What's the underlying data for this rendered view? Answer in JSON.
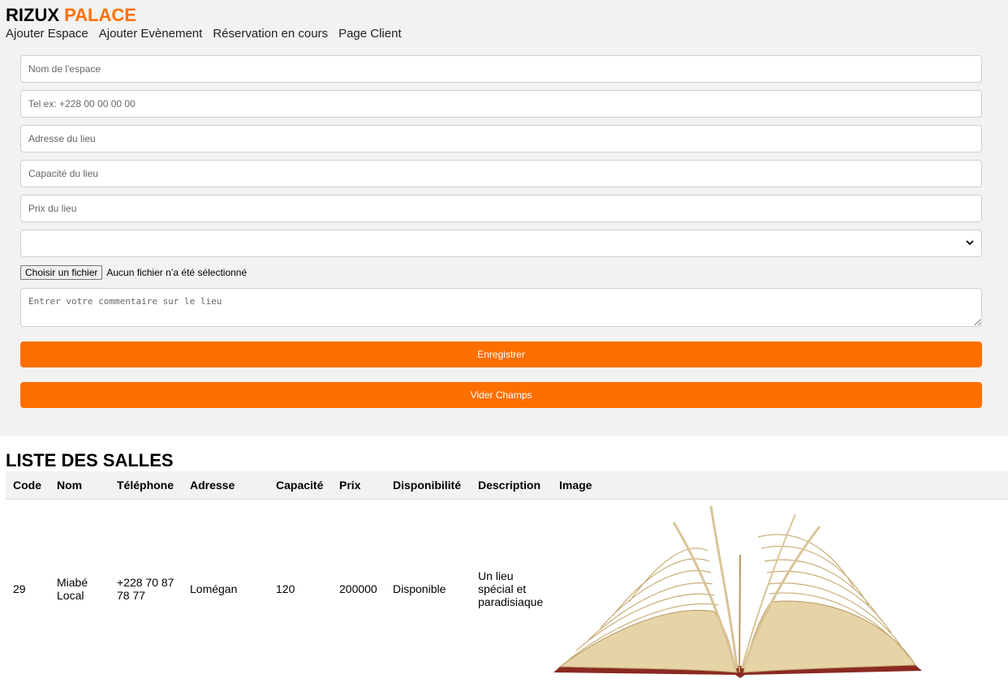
{
  "brand": {
    "name_part1": "RIZUX",
    "name_part2": "PALACE"
  },
  "nav": {
    "items": [
      "Ajouter Espace",
      "Ajouter Evènement",
      "Réservation en cours",
      "Page Client"
    ]
  },
  "form": {
    "nom_placeholder": "Nom de l'espace",
    "tel_placeholder": "Tel ex: +228 00 00 00 00",
    "adresse_placeholder": "Adresse du lieu",
    "capacite_placeholder": "Capacité du lieu",
    "prix_placeholder": "Prix du lieu",
    "select_value": "",
    "file_button": "Choisir un fichier",
    "file_status": "Aucun fichier n’a été sélectionné",
    "comment_placeholder": "Entrer votre commentaire sur le lieu",
    "save_button": "Enregistrer",
    "clear_button": "Vider Champs"
  },
  "list": {
    "title": "LISTE DES SALLES",
    "columns": [
      "Code",
      "Nom",
      "Téléphone",
      "Adresse",
      "Capacité",
      "Prix",
      "Disponibilité",
      "Description",
      "Image"
    ],
    "rows": [
      {
        "code": "29",
        "nom": "Miabé Local",
        "telephone": "+228 70 87 78 77",
        "adresse": "Lomégan",
        "capacite": "120",
        "prix": "200000",
        "disponibilite": "Disponible",
        "description": "Un lieu spécial et paradisiaque",
        "image": "open-book-image"
      }
    ]
  },
  "colors": {
    "accent": "#ff6f00",
    "panel_bg": "#f2f2f2"
  }
}
